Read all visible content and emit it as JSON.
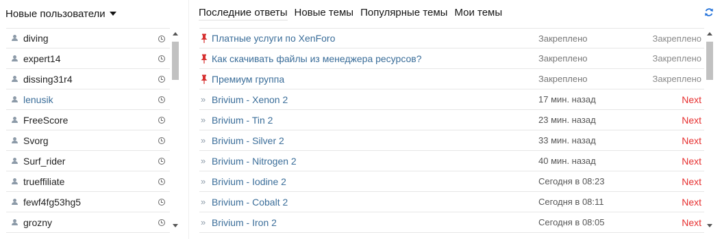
{
  "left": {
    "header": "Новые пользователи",
    "users": [
      {
        "name": "diving",
        "link": false
      },
      {
        "name": "expert14",
        "link": false
      },
      {
        "name": "dissing31r4",
        "link": false
      },
      {
        "name": "lenusik",
        "link": true
      },
      {
        "name": "FreeScore",
        "link": false
      },
      {
        "name": "Svorg",
        "link": false
      },
      {
        "name": "Surf_rider",
        "link": false
      },
      {
        "name": "trueffiliate",
        "link": false
      },
      {
        "name": "fewf4fg53hg5",
        "link": false
      },
      {
        "name": "grozny",
        "link": false
      }
    ]
  },
  "tabs": [
    "Последние ответы",
    "Новые темы",
    "Популярные темы",
    "Мои темы"
  ],
  "threads": [
    {
      "title": "Платные услуги по XenForo",
      "time": "Закреплено",
      "status": "Закреплено",
      "pinned": true
    },
    {
      "title": "Как скачивать файлы из менеджера ресурсов?",
      "time": "Закреплено",
      "status": "Закреплено",
      "pinned": true
    },
    {
      "title": "Премиум группа",
      "time": "Закреплено",
      "status": "Закреплено",
      "pinned": true
    },
    {
      "title": "Brivium - Xenon 2",
      "time": "17 мин. назад",
      "status": "Next",
      "pinned": false
    },
    {
      "title": "Brivium - Tin 2",
      "time": "23 мин. назад",
      "status": "Next",
      "pinned": false
    },
    {
      "title": "Brivium - Silver 2",
      "time": "33 мин. назад",
      "status": "Next",
      "pinned": false
    },
    {
      "title": "Brivium - Nitrogen 2",
      "time": "40 мин. назад",
      "status": "Next",
      "pinned": false
    },
    {
      "title": "Brivium - Iodine 2",
      "time": "Сегодня в 08:23",
      "status": "Next",
      "pinned": false
    },
    {
      "title": "Brivium - Cobalt 2",
      "time": "Сегодня в 08:11",
      "status": "Next",
      "pinned": false
    },
    {
      "title": "Brivium - Iron 2",
      "time": "Сегодня в 08:05",
      "status": "Next",
      "pinned": false
    }
  ],
  "icons": {
    "user": "user-icon",
    "clock": "clock-icon",
    "pin": "pin-icon",
    "chevron": "double-chevron-right-icon",
    "refresh": "refresh-icon"
  },
  "colors": {
    "link": "#3a6d99",
    "next": "#e62e2e",
    "pin": "#d63030",
    "refresh": "#1e6fd9"
  }
}
